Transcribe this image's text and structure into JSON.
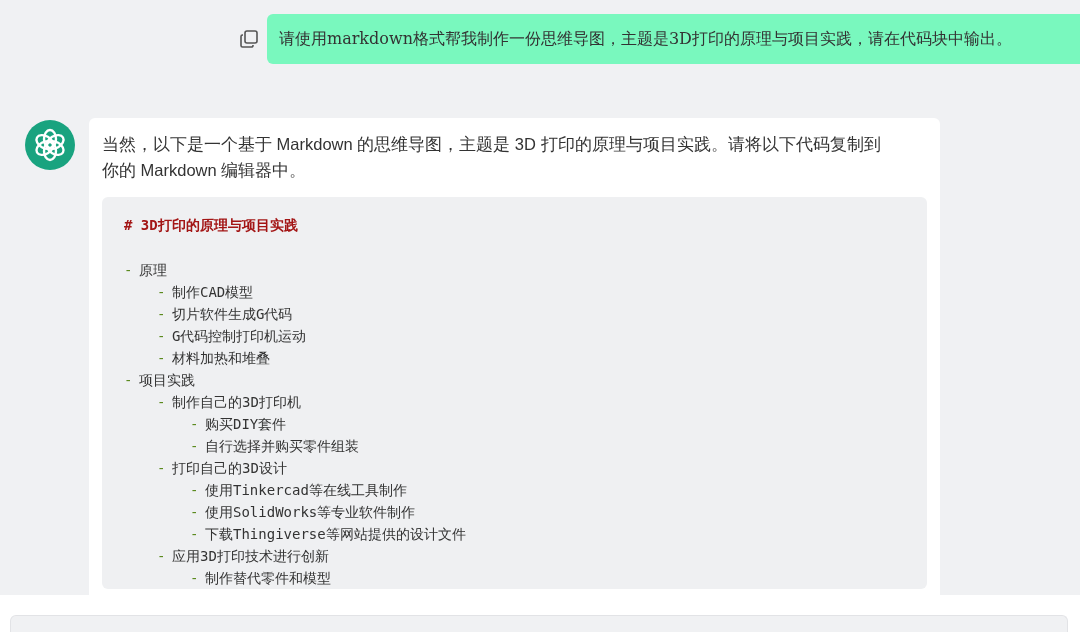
{
  "user_message": {
    "text": "请使用markdown格式帮我制作一份思维导图，主题是3D打印的原理与项目实践，请在代码块中输出。"
  },
  "assistant_message": {
    "text": "当然，以下是一个基于 Markdown 的思维导图，主题是 3D 打印的原理与项目实践。请将以下代码复制到你的 Markdown 编辑器中。",
    "code_block": {
      "heading": "# 3D打印的原理与项目实践",
      "items": [
        {
          "bullet": "-",
          "text": "原理",
          "children": [
            {
              "bullet": "-",
              "text": "制作CAD模型"
            },
            {
              "bullet": "-",
              "text": "切片软件生成G代码"
            },
            {
              "bullet": "-",
              "text": "G代码控制打印机运动"
            },
            {
              "bullet": "-",
              "text": "材料加热和堆叠"
            }
          ]
        },
        {
          "bullet": "-",
          "text": "项目实践",
          "children": [
            {
              "bullet": "-",
              "text": "制作自己的3D打印机",
              "children": [
                {
                  "bullet": "-",
                  "text": "购买DIY套件"
                },
                {
                  "bullet": "-",
                  "text": "自行选择并购买零件组装"
                }
              ]
            },
            {
              "bullet": "-",
              "text": "打印自己的3D设计",
              "children": [
                {
                  "bullet": "-",
                  "text": "使用Tinkercad等在线工具制作"
                },
                {
                  "bullet": "-",
                  "text": "使用SolidWorks等专业软件制作"
                },
                {
                  "bullet": "-",
                  "text": "下载Thingiverse等网站提供的设计文件"
                }
              ]
            },
            {
              "bullet": "-",
              "text": "应用3D打印技术进行创新",
              "children": [
                {
                  "bullet": "-",
                  "text": "制作替代零件和模型"
                }
              ]
            }
          ]
        }
      ]
    }
  }
}
